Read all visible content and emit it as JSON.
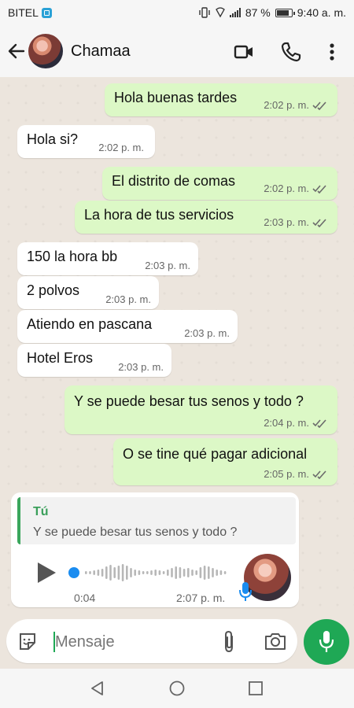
{
  "status_bar": {
    "carrier": "BITEL",
    "battery_percent": "87 %",
    "battery_level": 0.87,
    "time": "9:40 a. m."
  },
  "header": {
    "contact_name": "Chamaa",
    "icons": [
      "back-arrow-icon",
      "video-call-icon",
      "phone-call-icon",
      "more-vert-icon"
    ]
  },
  "messages": [
    {
      "dir": "out",
      "text": "Hola buenas tardes",
      "time": "2:02 p. m.",
      "read": true
    },
    {
      "dir": "in",
      "text": "Hola si?",
      "time": "2:02 p. m."
    },
    {
      "dir": "out",
      "text": "El distrito de comas",
      "time": "2:02 p. m.",
      "read": true
    },
    {
      "dir": "out",
      "text": "La hora de tus servicios",
      "time": "2:03 p. m.",
      "read": true
    },
    {
      "dir": "in",
      "text": "150 la hora bb",
      "time": "2:03 p. m."
    },
    {
      "dir": "in",
      "text": "2 polvos",
      "time": "2:03 p. m."
    },
    {
      "dir": "in",
      "text": "Atiendo en pascana",
      "time": "2:03 p. m."
    },
    {
      "dir": "in",
      "text": "Hotel Eros",
      "time": "2:03 p. m."
    },
    {
      "dir": "out",
      "text": "Y se puede besar tus senos y todo ?",
      "time": "2:04 p. m.",
      "read": true
    },
    {
      "dir": "out",
      "text": "O se tine qué pagar adicional",
      "time": "2:05 p. m.",
      "read": true
    }
  ],
  "voice_message": {
    "reply_author": "Tú",
    "reply_text": "Y se puede besar tus senos y todo ?",
    "duration": "0:04",
    "time": "2:07 p. m.",
    "progress": 0.0
  },
  "composer": {
    "placeholder": "Mensaje",
    "icons": [
      "sticker-icon",
      "attach-icon",
      "camera-icon",
      "mic-icon"
    ]
  },
  "colors": {
    "outgoing_bubble": "#dcf8c6",
    "incoming_bubble": "#ffffff",
    "accent_green": "#1fa855",
    "read_ticks": "#6b6b6b",
    "voice_progress": "#1a8cf0"
  }
}
